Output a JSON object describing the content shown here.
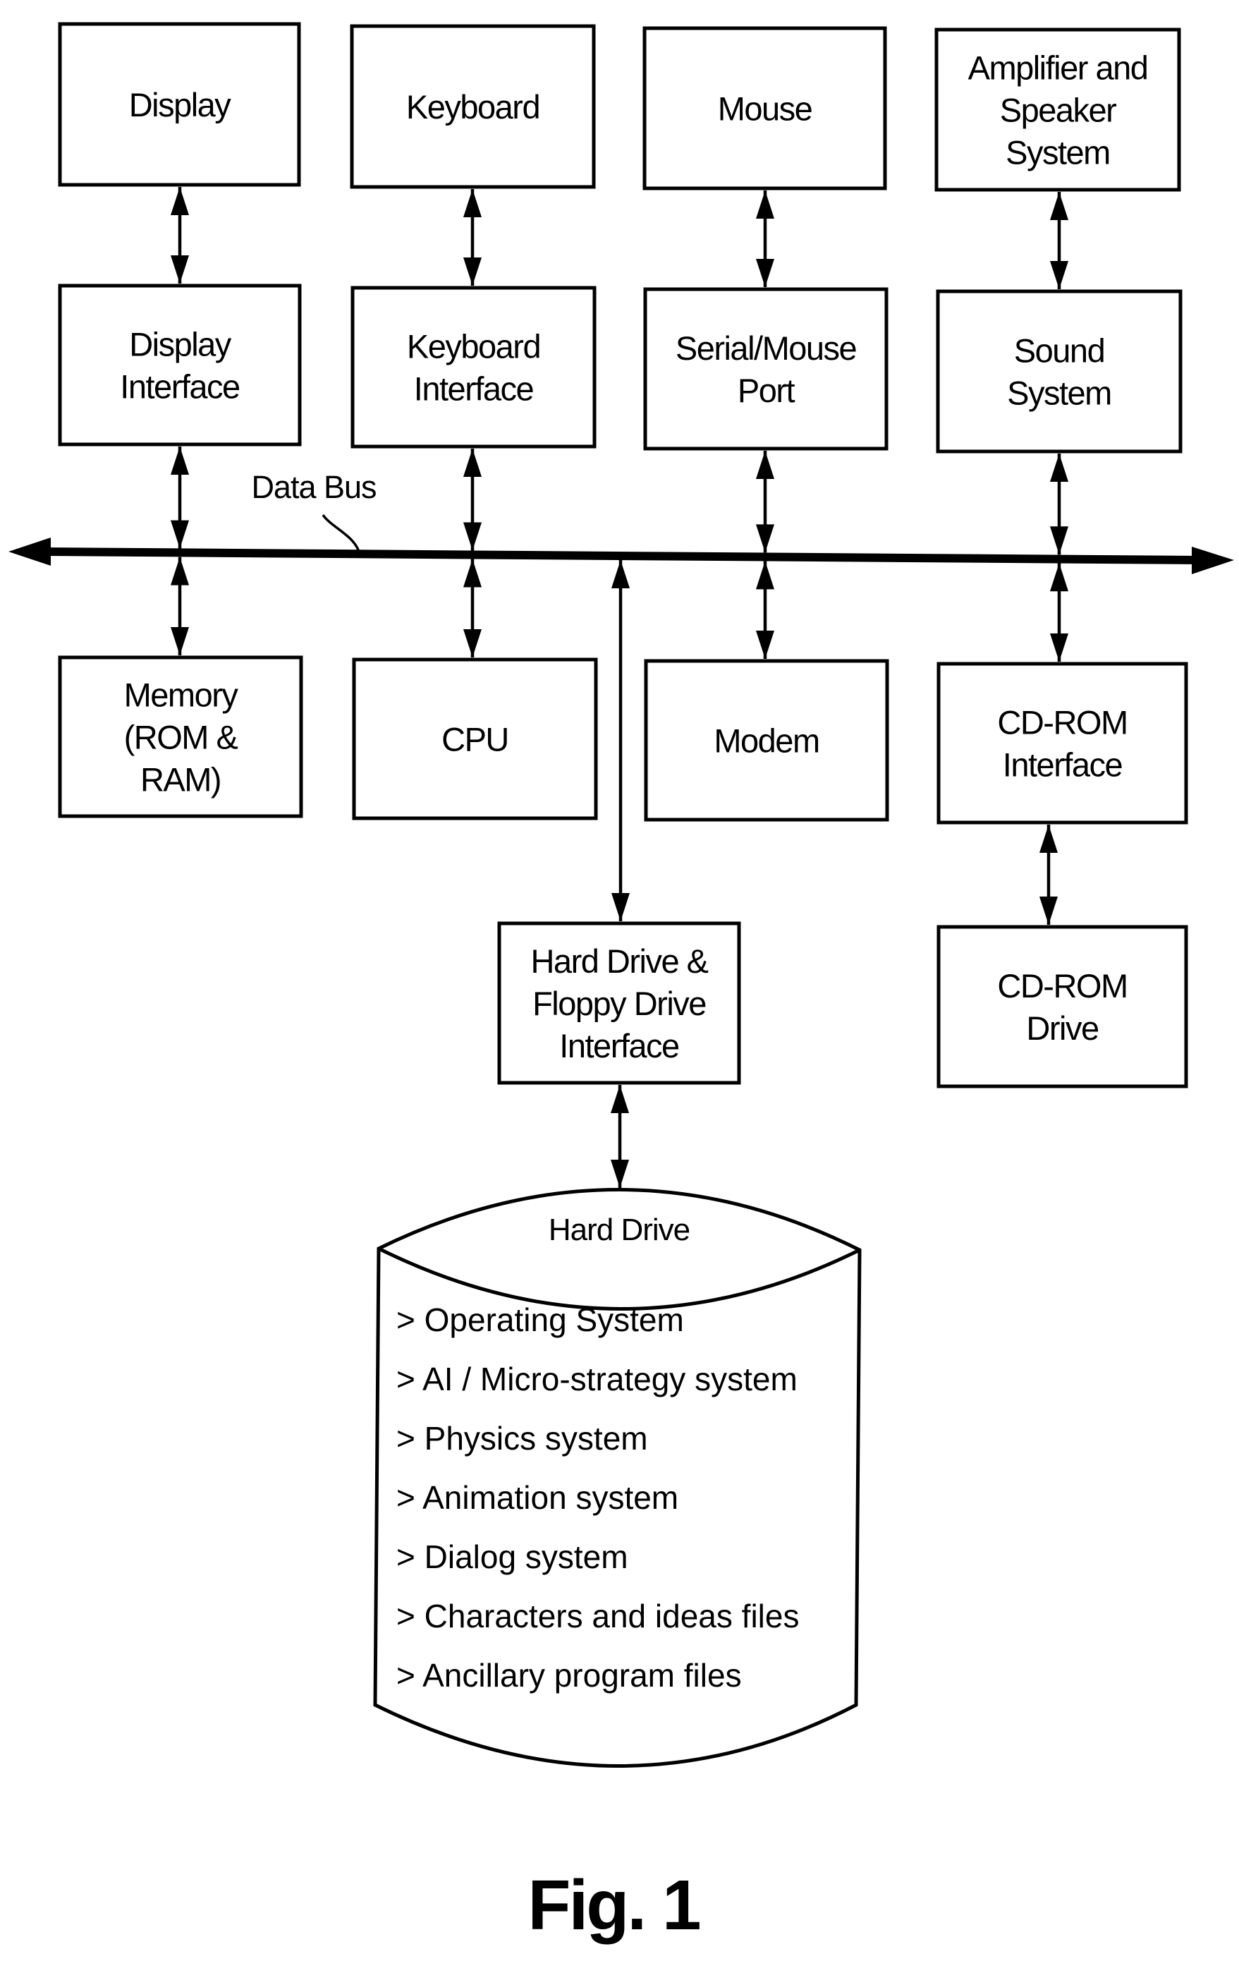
{
  "figure": {
    "caption": "Fig. 1",
    "bus_label": "Data Bus"
  },
  "components": {
    "display": {
      "lines": [
        "Display"
      ]
    },
    "keyboard": {
      "lines": [
        "Keyboard"
      ]
    },
    "mouse": {
      "lines": [
        "Mouse"
      ]
    },
    "amplifier": {
      "lines": [
        "Amplifier and",
        "Speaker",
        "System"
      ]
    },
    "display_interface": {
      "lines": [
        "Display",
        "Interface"
      ]
    },
    "keyboard_interface": {
      "lines": [
        "Keyboard",
        "Interface"
      ]
    },
    "serial_mouse_port": {
      "lines": [
        "Serial/Mouse",
        "Port"
      ]
    },
    "sound_system": {
      "lines": [
        "Sound",
        "System"
      ]
    },
    "memory": {
      "lines": [
        "Memory",
        "(ROM &",
        "RAM)"
      ]
    },
    "cpu": {
      "lines": [
        "CPU"
      ]
    },
    "modem": {
      "lines": [
        "Modem"
      ]
    },
    "cdrom_interface": {
      "lines": [
        "CD-ROM",
        "Interface"
      ]
    },
    "hd_interface": {
      "lines": [
        "Hard Drive &",
        "Floppy Drive",
        "Interface"
      ]
    },
    "cdrom_drive": {
      "lines": [
        "CD-ROM",
        "Drive"
      ]
    }
  },
  "hard_drive": {
    "title": "Hard Drive",
    "items": [
      "> Operating System",
      "> AI / Micro-strategy system",
      "> Physics system",
      "> Animation system",
      "> Dialog system",
      "> Characters and ideas files",
      "> Ancillary program files"
    ]
  },
  "connections": [
    {
      "from": "display",
      "to": "display_interface",
      "type": "bidirectional"
    },
    {
      "from": "keyboard",
      "to": "keyboard_interface",
      "type": "bidirectional"
    },
    {
      "from": "mouse",
      "to": "serial_mouse_port",
      "type": "bidirectional"
    },
    {
      "from": "amplifier",
      "to": "sound_system",
      "type": "bidirectional"
    },
    {
      "from": "display_interface",
      "to": "data_bus",
      "type": "bidirectional"
    },
    {
      "from": "keyboard_interface",
      "to": "data_bus",
      "type": "bidirectional"
    },
    {
      "from": "serial_mouse_port",
      "to": "data_bus",
      "type": "bidirectional"
    },
    {
      "from": "sound_system",
      "to": "data_bus",
      "type": "bidirectional"
    },
    {
      "from": "data_bus",
      "to": "memory",
      "type": "bidirectional"
    },
    {
      "from": "data_bus",
      "to": "cpu",
      "type": "bidirectional"
    },
    {
      "from": "data_bus",
      "to": "modem",
      "type": "bidirectional"
    },
    {
      "from": "data_bus",
      "to": "cdrom_interface",
      "type": "bidirectional"
    },
    {
      "from": "data_bus",
      "to": "hd_interface",
      "type": "bidirectional"
    },
    {
      "from": "cdrom_interface",
      "to": "cdrom_drive",
      "type": "bidirectional"
    },
    {
      "from": "hd_interface",
      "to": "hard_drive",
      "type": "bidirectional"
    }
  ]
}
